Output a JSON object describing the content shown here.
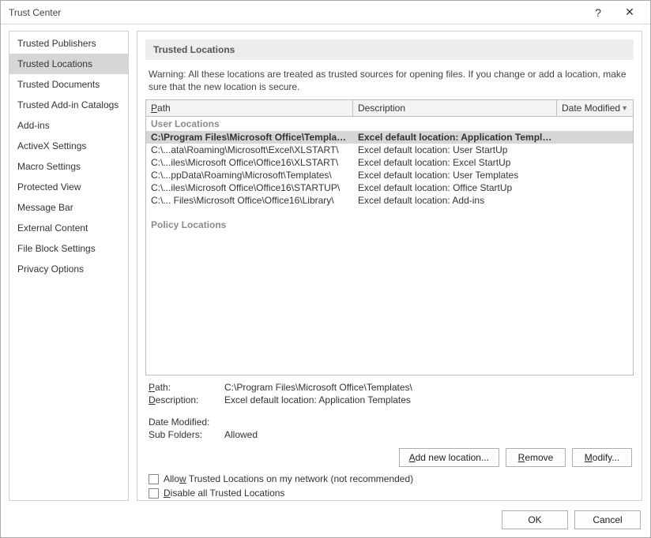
{
  "window": {
    "title": "Trust Center",
    "help": "?",
    "close": "✕"
  },
  "sidebar": {
    "items": [
      "Trusted Publishers",
      "Trusted Locations",
      "Trusted Documents",
      "Trusted Add-in Catalogs",
      "Add-ins",
      "ActiveX Settings",
      "Macro Settings",
      "Protected View",
      "Message Bar",
      "External Content",
      "File Block Settings",
      "Privacy Options"
    ],
    "selectedIndex": 1
  },
  "main": {
    "heading": "Trusted Locations",
    "warning": "Warning: All these locations are treated as trusted sources for opening files.  If you change or add a location, make sure that the new location is secure.",
    "columns": {
      "path": "Path",
      "desc": "Description",
      "date": "Date Modified"
    },
    "groups": {
      "user": "User Locations",
      "policy": "Policy Locations"
    },
    "rows": [
      {
        "path": "C:\\Program Files\\Microsoft Office\\Templates\\",
        "desc": "Excel default location: Application Templates",
        "date": "",
        "selected": true
      },
      {
        "path": "C:\\...ata\\Roaming\\Microsoft\\Excel\\XLSTART\\",
        "desc": "Excel default location: User StartUp",
        "date": ""
      },
      {
        "path": "C:\\...iles\\Microsoft Office\\Office16\\XLSTART\\",
        "desc": "Excel default location: Excel StartUp",
        "date": ""
      },
      {
        "path": "C:\\...ppData\\Roaming\\Microsoft\\Templates\\",
        "desc": "Excel default location: User Templates",
        "date": ""
      },
      {
        "path": "C:\\...iles\\Microsoft Office\\Office16\\STARTUP\\",
        "desc": "Excel default location: Office StartUp",
        "date": ""
      },
      {
        "path": "C:\\... Files\\Microsoft Office\\Office16\\Library\\",
        "desc": "Excel default location: Add-ins",
        "date": ""
      }
    ],
    "details": {
      "path_label": "Path:",
      "path_value": "C:\\Program Files\\Microsoft Office\\Templates\\",
      "desc_label": "Description:",
      "desc_value": "Excel default location: Application Templates",
      "date_label": "Date Modified:",
      "date_value": "",
      "sub_label": "Sub Folders:",
      "sub_value": "Allowed"
    },
    "buttons": {
      "add": "Add new location...",
      "remove": "Remove",
      "modify": "Modify..."
    },
    "checks": {
      "network": "Allow Trusted Locations on my network (not recommended)",
      "disable": "Disable all Trusted Locations"
    }
  },
  "footer": {
    "ok": "OK",
    "cancel": "Cancel"
  }
}
